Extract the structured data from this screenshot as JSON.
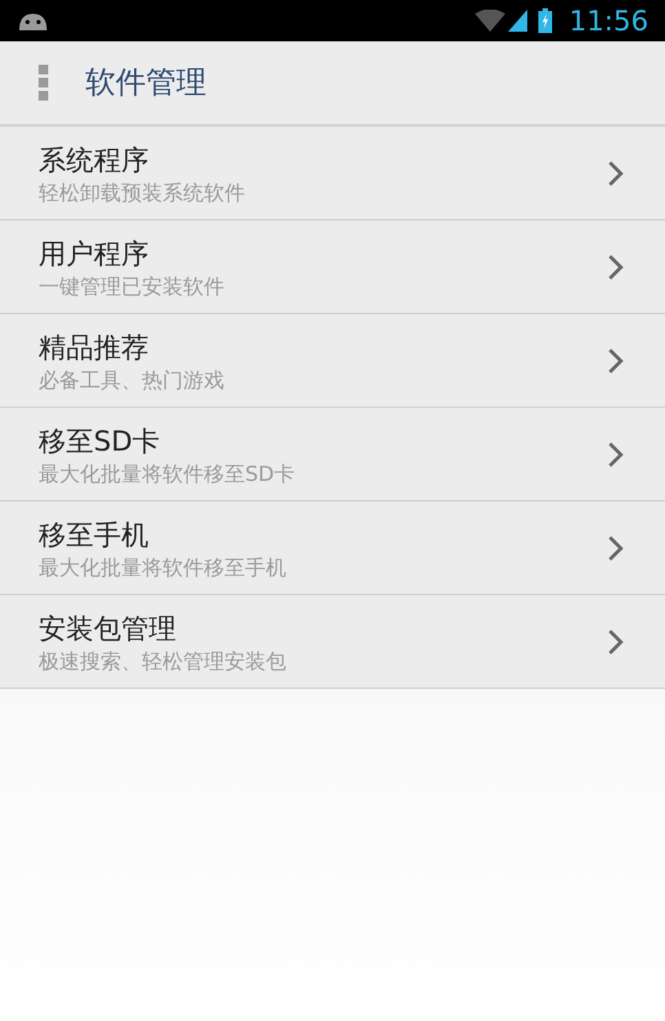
{
  "status_bar": {
    "time": "11:56"
  },
  "header": {
    "title": "软件管理"
  },
  "menu": [
    {
      "title": "系统程序",
      "subtitle": "轻松卸载预装系统软件"
    },
    {
      "title": "用户程序",
      "subtitle": "一键管理已安装软件"
    },
    {
      "title": "精品推荐",
      "subtitle": "必备工具、热门游戏"
    },
    {
      "title": "移至SD卡",
      "subtitle": "最大化批量将软件移至SD卡"
    },
    {
      "title": "移至手机",
      "subtitle": "最大化批量将软件移至手机"
    },
    {
      "title": "安装包管理",
      "subtitle": "极速搜索、轻松管理安装包"
    }
  ]
}
